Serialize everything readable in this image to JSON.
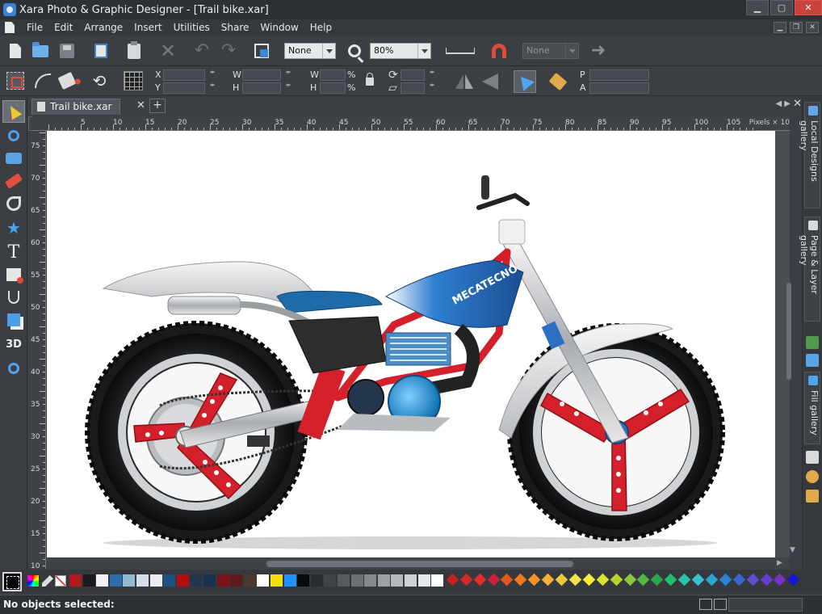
{
  "window": {
    "title": "Xara Photo & Graphic Designer - [Trail bike.xar]",
    "minimize_icon": "minimize-icon",
    "maximize_icon": "maximize-icon",
    "close_icon": "close-icon"
  },
  "menu": {
    "items": [
      "File",
      "Edit",
      "Arrange",
      "Insert",
      "Utilities",
      "Share",
      "Window",
      "Help"
    ]
  },
  "toolbar": {
    "quality_select": "None",
    "zoom_select": "80%",
    "disabled_select": "None"
  },
  "infobar": {
    "x_label": "X",
    "y_label": "Y",
    "w_label": "W",
    "h_label": "H",
    "w_pct_label": "W",
    "h_pct_label": "H",
    "percent": "%",
    "p_label": "P",
    "a_label": "A"
  },
  "document_tab": {
    "name": "Trail bike.xar",
    "close": "✕",
    "add": "+"
  },
  "ruler": {
    "units": "Pixels × 10",
    "corner": "+",
    "h_numbers": [
      "5",
      "10",
      "15",
      "20",
      "25",
      "30",
      "35",
      "40",
      "45",
      "50",
      "55",
      "60",
      "65",
      "70",
      "75",
      "80",
      "85",
      "90",
      "95",
      "100",
      "105"
    ],
    "v_numbers": [
      "75",
      "70",
      "65",
      "60",
      "55",
      "50",
      "45",
      "40",
      "35",
      "30",
      "25",
      "20",
      "15",
      "10"
    ]
  },
  "galleries": {
    "local_designs": "Local Designs gallery",
    "page_layer": "Page & Layer gallery",
    "fill": "Fill gallery"
  },
  "artwork": {
    "tank_logo": "MECATECNO"
  },
  "palette": {
    "swatches": [
      "#b11a1a",
      "#1a1a1a",
      "#f2f2f2",
      "#2a6fa8",
      "#93b8d4",
      "#d6dfe8",
      "#e9ecef",
      "#1e4f82",
      "#b30f12",
      "#23364e",
      "#16324f",
      "#7a1416",
      "#5e1a1c",
      "#4b3a2c",
      "#ffffff",
      "#f7e000",
      "#1e90ff",
      "#0a0a0a",
      "#2b2b2b",
      "#444444",
      "#5a5a5a",
      "#707070",
      "#888888",
      "#a0a0a0",
      "#b8b8b8",
      "#d0d0d0",
      "#e8e8e8",
      "#ffffff"
    ],
    "diamonds": [
      "#c9211e",
      "#d42a28",
      "#e0302c",
      "#cf1f3f",
      "#e05a1e",
      "#f07a1f",
      "#f3942a",
      "#f6b03a",
      "#e9c842",
      "#f4e24b",
      "#f7ec3c",
      "#d9e030",
      "#b9d330",
      "#8cc63f",
      "#4fb848",
      "#26a84b",
      "#1fbf6d",
      "#29c2a3",
      "#39c0d0",
      "#2aa5d4",
      "#2b83d1",
      "#3c66d0",
      "#5f4fd0",
      "#6a3cd0",
      "#7b32c9",
      "#1414d8"
    ]
  },
  "status": {
    "message": "No objects selected:"
  },
  "colors": {
    "chrome": "#3b3e43",
    "canvas": "#ffffff",
    "accent": "#4ea4ef",
    "bike_red": "#d3202a",
    "bike_blue": "#1f5fa5"
  }
}
